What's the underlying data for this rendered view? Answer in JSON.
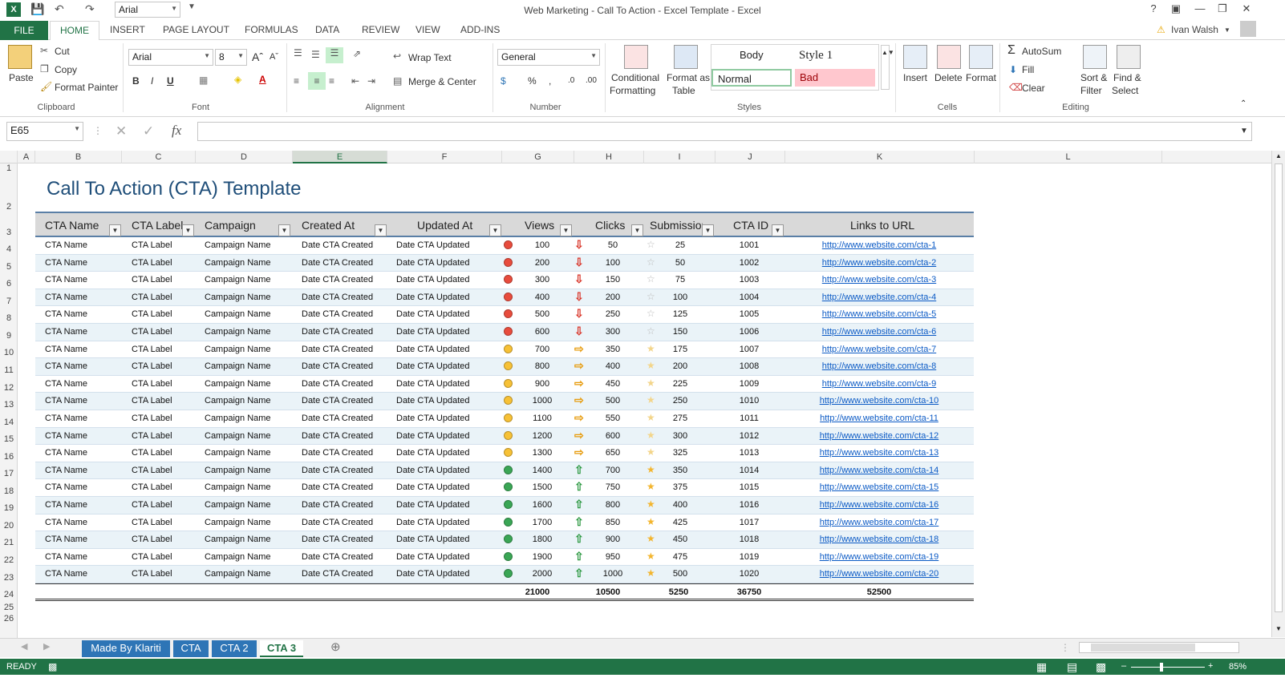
{
  "window": {
    "title": "Web Marketing - Call To Action - Excel Template - Excel",
    "font_box": "Arial",
    "help": "?",
    "user": "Ivan Walsh"
  },
  "ribbon_tabs": [
    "FILE",
    "HOME",
    "INSERT",
    "PAGE LAYOUT",
    "FORMULAS",
    "DATA",
    "REVIEW",
    "VIEW",
    "ADD-INS"
  ],
  "ribbon": {
    "clipboard": {
      "paste": "Paste",
      "cut": "Cut",
      "copy": "Copy",
      "format_painter": "Format Painter",
      "label": "Clipboard"
    },
    "font": {
      "name": "Arial",
      "size": "8",
      "bold": "B",
      "italic": "I",
      "underline": "U",
      "label": "Font"
    },
    "alignment": {
      "wrap": "Wrap Text",
      "merge": "Merge & Center",
      "label": "Alignment"
    },
    "number": {
      "format": "General",
      "label": "Number"
    },
    "styles": {
      "conditional": "Conditional",
      "conditional2": "Formatting",
      "format_as": "Format as",
      "format_as2": "Table",
      "body": "Body",
      "style1": "Style 1",
      "normal": "Normal",
      "bad": "Bad",
      "label": "Styles"
    },
    "cells": {
      "insert": "Insert",
      "delete": "Delete",
      "format": "Format",
      "label": "Cells"
    },
    "editing": {
      "autosum": "AutoSum",
      "fill": "Fill",
      "clear": "Clear",
      "sort": "Sort &",
      "sort2": "Filter",
      "find": "Find &",
      "find2": "Select",
      "label": "Editing"
    }
  },
  "formula_bar": {
    "name_box": "E65",
    "fx": "fx",
    "value": ""
  },
  "columns": [
    "A",
    "B",
    "C",
    "D",
    "E",
    "F",
    "G",
    "H",
    "I",
    "J",
    "K",
    "L"
  ],
  "row_numbers": [
    "1",
    "2",
    "3",
    "4",
    "5",
    "6",
    "7",
    "8",
    "9",
    "10",
    "11",
    "12",
    "13",
    "14",
    "15",
    "16",
    "17",
    "18",
    "19",
    "20",
    "21",
    "22",
    "23",
    "24",
    "25",
    "26"
  ],
  "sheet": {
    "title": "Call To Action (CTA) Template",
    "headers": [
      "CTA Name",
      "CTA Label",
      "Campaign",
      "Created At",
      "Updated At",
      "Views",
      "Clicks",
      "Submission",
      "CTA ID",
      "Links to URL"
    ],
    "rows": [
      {
        "name": "CTA Name",
        "label": "CTA Label",
        "campaign": "Campaign Name",
        "created": "Date CTA Created",
        "updated": "Date CTA Updated",
        "views": "100",
        "clicks": "50",
        "subs": "25",
        "id": "1001",
        "url": "http://www.website.com/cta-1",
        "level": "red"
      },
      {
        "name": "CTA Name",
        "label": "CTA Label",
        "campaign": "Campaign Name",
        "created": "Date CTA Created",
        "updated": "Date CTA Updated",
        "views": "200",
        "clicks": "100",
        "subs": "50",
        "id": "1002",
        "url": "http://www.website.com/cta-2",
        "level": "red"
      },
      {
        "name": "CTA Name",
        "label": "CTA Label",
        "campaign": "Campaign Name",
        "created": "Date CTA Created",
        "updated": "Date CTA Updated",
        "views": "300",
        "clicks": "150",
        "subs": "75",
        "id": "1003",
        "url": "http://www.website.com/cta-3",
        "level": "red"
      },
      {
        "name": "CTA Name",
        "label": "CTA Label",
        "campaign": "Campaign Name",
        "created": "Date CTA Created",
        "updated": "Date CTA Updated",
        "views": "400",
        "clicks": "200",
        "subs": "100",
        "id": "1004",
        "url": "http://www.website.com/cta-4",
        "level": "red"
      },
      {
        "name": "CTA Name",
        "label": "CTA Label",
        "campaign": "Campaign Name",
        "created": "Date CTA Created",
        "updated": "Date CTA Updated",
        "views": "500",
        "clicks": "250",
        "subs": "125",
        "id": "1005",
        "url": "http://www.website.com/cta-5",
        "level": "red"
      },
      {
        "name": "CTA Name",
        "label": "CTA Label",
        "campaign": "Campaign Name",
        "created": "Date CTA Created",
        "updated": "Date CTA Updated",
        "views": "600",
        "clicks": "300",
        "subs": "150",
        "id": "1006",
        "url": "http://www.website.com/cta-6",
        "level": "red"
      },
      {
        "name": "CTA Name",
        "label": "CTA Label",
        "campaign": "Campaign Name",
        "created": "Date CTA Created",
        "updated": "Date CTA Updated",
        "views": "700",
        "clicks": "350",
        "subs": "175",
        "id": "1007",
        "url": "http://www.website.com/cta-7",
        "level": "yellow"
      },
      {
        "name": "CTA Name",
        "label": "CTA Label",
        "campaign": "Campaign Name",
        "created": "Date CTA Created",
        "updated": "Date CTA Updated",
        "views": "800",
        "clicks": "400",
        "subs": "200",
        "id": "1008",
        "url": "http://www.website.com/cta-8",
        "level": "yellow"
      },
      {
        "name": "CTA Name",
        "label": "CTA Label",
        "campaign": "Campaign Name",
        "created": "Date CTA Created",
        "updated": "Date CTA Updated",
        "views": "900",
        "clicks": "450",
        "subs": "225",
        "id": "1009",
        "url": "http://www.website.com/cta-9",
        "level": "yellow"
      },
      {
        "name": "CTA Name",
        "label": "CTA Label",
        "campaign": "Campaign Name",
        "created": "Date CTA Created",
        "updated": "Date CTA Updated",
        "views": "1000",
        "clicks": "500",
        "subs": "250",
        "id": "1010",
        "url": "http://www.website.com/cta-10",
        "level": "yellow"
      },
      {
        "name": "CTA Name",
        "label": "CTA Label",
        "campaign": "Campaign Name",
        "created": "Date CTA Created",
        "updated": "Date CTA Updated",
        "views": "1100",
        "clicks": "550",
        "subs": "275",
        "id": "1011",
        "url": "http://www.website.com/cta-11",
        "level": "yellow"
      },
      {
        "name": "CTA Name",
        "label": "CTA Label",
        "campaign": "Campaign Name",
        "created": "Date CTA Created",
        "updated": "Date CTA Updated",
        "views": "1200",
        "clicks": "600",
        "subs": "300",
        "id": "1012",
        "url": "http://www.website.com/cta-12",
        "level": "yellow"
      },
      {
        "name": "CTA Name",
        "label": "CTA Label",
        "campaign": "Campaign Name",
        "created": "Date CTA Created",
        "updated": "Date CTA Updated",
        "views": "1300",
        "clicks": "650",
        "subs": "325",
        "id": "1013",
        "url": "http://www.website.com/cta-13",
        "level": "yellow"
      },
      {
        "name": "CTA Name",
        "label": "CTA Label",
        "campaign": "Campaign Name",
        "created": "Date CTA Created",
        "updated": "Date CTA Updated",
        "views": "1400",
        "clicks": "700",
        "subs": "350",
        "id": "1014",
        "url": "http://www.website.com/cta-14",
        "level": "green"
      },
      {
        "name": "CTA Name",
        "label": "CTA Label",
        "campaign": "Campaign Name",
        "created": "Date CTA Created",
        "updated": "Date CTA Updated",
        "views": "1500",
        "clicks": "750",
        "subs": "375",
        "id": "1015",
        "url": "http://www.website.com/cta-15",
        "level": "green"
      },
      {
        "name": "CTA Name",
        "label": "CTA Label",
        "campaign": "Campaign Name",
        "created": "Date CTA Created",
        "updated": "Date CTA Updated",
        "views": "1600",
        "clicks": "800",
        "subs": "400",
        "id": "1016",
        "url": "http://www.website.com/cta-16",
        "level": "green"
      },
      {
        "name": "CTA Name",
        "label": "CTA Label",
        "campaign": "Campaign Name",
        "created": "Date CTA Created",
        "updated": "Date CTA Updated",
        "views": "1700",
        "clicks": "850",
        "subs": "425",
        "id": "1017",
        "url": "http://www.website.com/cta-17",
        "level": "green"
      },
      {
        "name": "CTA Name",
        "label": "CTA Label",
        "campaign": "Campaign Name",
        "created": "Date CTA Created",
        "updated": "Date CTA Updated",
        "views": "1800",
        "clicks": "900",
        "subs": "450",
        "id": "1018",
        "url": "http://www.website.com/cta-18",
        "level": "green"
      },
      {
        "name": "CTA Name",
        "label": "CTA Label",
        "campaign": "Campaign Name",
        "created": "Date CTA Created",
        "updated": "Date CTA Updated",
        "views": "1900",
        "clicks": "950",
        "subs": "475",
        "id": "1019",
        "url": "http://www.website.com/cta-19",
        "level": "green"
      },
      {
        "name": "CTA Name",
        "label": "CTA Label",
        "campaign": "Campaign Name",
        "created": "Date CTA Created",
        "updated": "Date CTA Updated",
        "views": "2000",
        "clicks": "1000",
        "subs": "500",
        "id": "1020",
        "url": "http://www.website.com/cta-20",
        "level": "green"
      }
    ],
    "totals": {
      "views": "21000",
      "clicks": "10500",
      "subs": "5250",
      "id": "36750",
      "url": "52500"
    },
    "colors": {
      "red": "#e84c3d",
      "yellow": "#f7c136",
      "green": "#3aa655"
    }
  },
  "sheet_tabs": [
    "Made By Klariti",
    "CTA",
    "CTA 2",
    "CTA 3"
  ],
  "status": {
    "ready": "READY",
    "zoom": "85%"
  }
}
